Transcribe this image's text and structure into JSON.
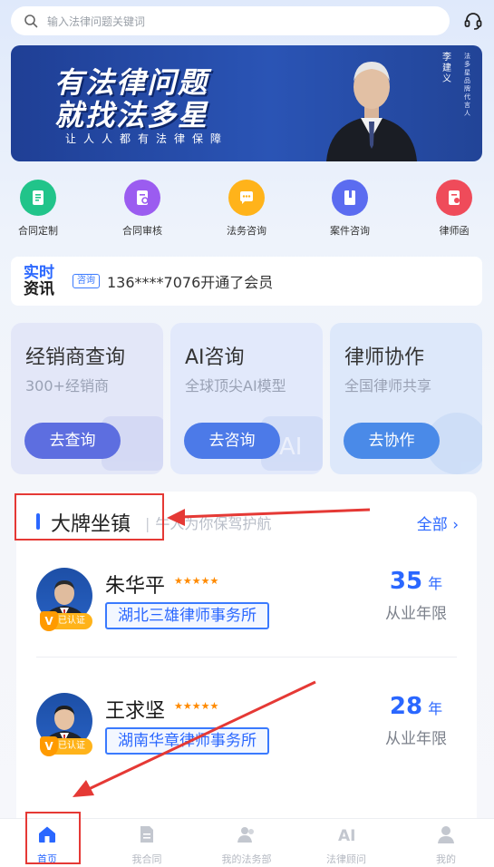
{
  "search": {
    "placeholder": "输入法律问题关键词"
  },
  "banner": {
    "line1": "有法律问题",
    "line2": "就找法多星",
    "slogan": "让人人都有法律保障",
    "person_name": "李建义",
    "person_desc": "法多星品牌代言人"
  },
  "quick_items": [
    {
      "label": "合同定制",
      "icon": "contract-customize-icon",
      "color": "#21c48a"
    },
    {
      "label": "合同审核",
      "icon": "contract-review-icon",
      "color": "#9b5cf0"
    },
    {
      "label": "法务咨询",
      "icon": "legal-consult-icon",
      "color": "#ffb31a"
    },
    {
      "label": "案件咨询",
      "icon": "case-consult-icon",
      "color": "#5b6cf0"
    },
    {
      "label": "律师函",
      "icon": "lawyer-letter-icon",
      "color": "#ef4b5a"
    }
  ],
  "news": {
    "logo_line1": "实时",
    "logo_line2": "资讯",
    "tag": "咨询",
    "text": "136****7076开通了会员"
  },
  "cards": [
    {
      "title": "经销商查询",
      "desc": "300+经销商",
      "button": "去查询",
      "bg": "#e3e7f8",
      "btn_color": "#5d6ee0"
    },
    {
      "title": "AI咨询",
      "desc": "全球顶尖AI模型",
      "button": "去咨询",
      "bg": "#e2e9fb",
      "btn_color": "#4c7ae8"
    },
    {
      "title": "律师协作",
      "desc": "全国律师共享",
      "button": "去协作",
      "bg": "#dde8fa",
      "btn_color": "#4a8ae8"
    }
  ],
  "section": {
    "title": "大牌坐镇",
    "subtitle": "牛人为你保驾护航",
    "all_link": "全部 ›"
  },
  "lawyers": [
    {
      "name": "朱华平",
      "stars": "★★★★★",
      "firm": "湖北三雄律师事务所",
      "years": "35",
      "unit": "年",
      "years_label": "从业年限",
      "badge": "已认证"
    },
    {
      "name": "王求坚",
      "stars": "★★★★★",
      "firm": "湖南华章律师事务所",
      "years": "28",
      "unit": "年",
      "years_label": "从业年限",
      "badge": "已认证"
    }
  ],
  "tabs": [
    {
      "label": "首页",
      "icon": "home-icon",
      "active": true
    },
    {
      "label": "我合同",
      "icon": "contract-icon",
      "active": false
    },
    {
      "label": "我的法务部",
      "icon": "legal-dept-icon",
      "active": false
    },
    {
      "label": "法律顾问",
      "icon": "ai-icon",
      "active": false
    },
    {
      "label": "我的",
      "icon": "profile-icon",
      "active": false
    }
  ],
  "colors": {
    "accent": "#2a67ff",
    "annotation": "#e53935"
  }
}
